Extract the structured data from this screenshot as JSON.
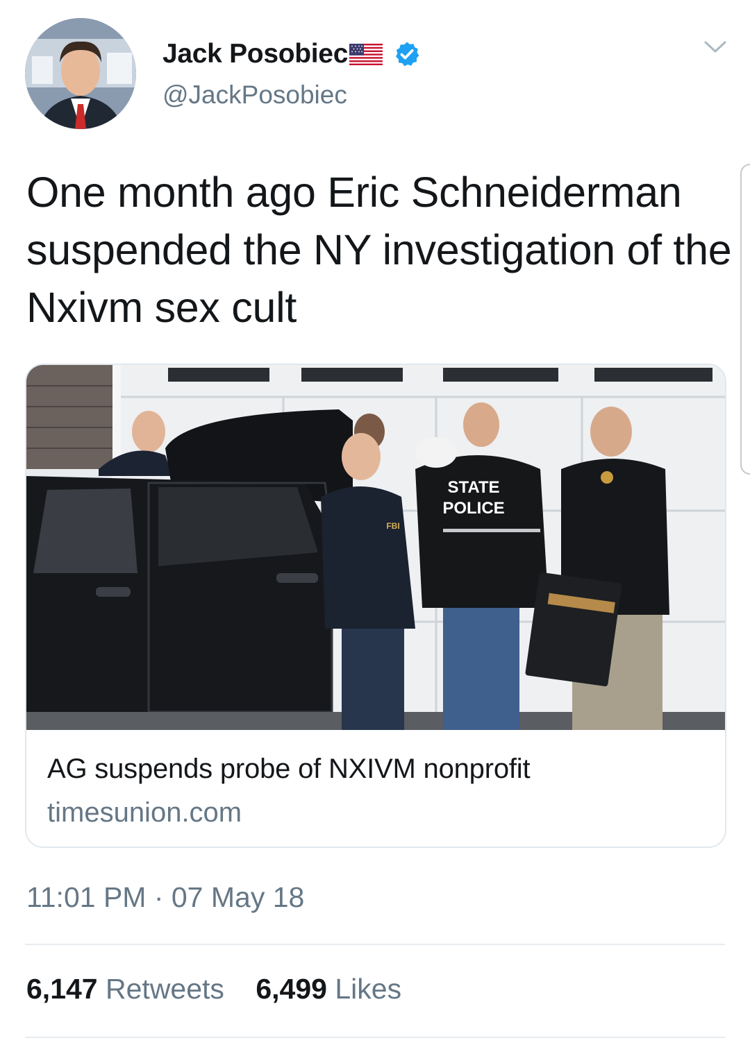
{
  "author": {
    "name": "Jack Posobiec",
    "handle": "@JackPosobiec",
    "flag_icon": "us-flag-icon",
    "verified_icon": "verified-badge-icon"
  },
  "tweet": {
    "text": "One month ago Eric Schneiderman suspended the NY investigation of the Nxivm sex cult",
    "timestamp": "11:01 PM · 07 May 18"
  },
  "link_card": {
    "photo_labels": [
      "STATE",
      "POLICE",
      "FBI"
    ],
    "title": "AG suspends probe of NXIVM nonprofit",
    "domain": "timesunion.com"
  },
  "stats": {
    "retweets_count": "6,147",
    "retweets_label": "Retweets",
    "likes_count": "6,499",
    "likes_label": "Likes"
  },
  "colors": {
    "text": "#14171a",
    "secondary": "#657786",
    "verified": "#1da1f2",
    "border": "#e1e8ed"
  }
}
